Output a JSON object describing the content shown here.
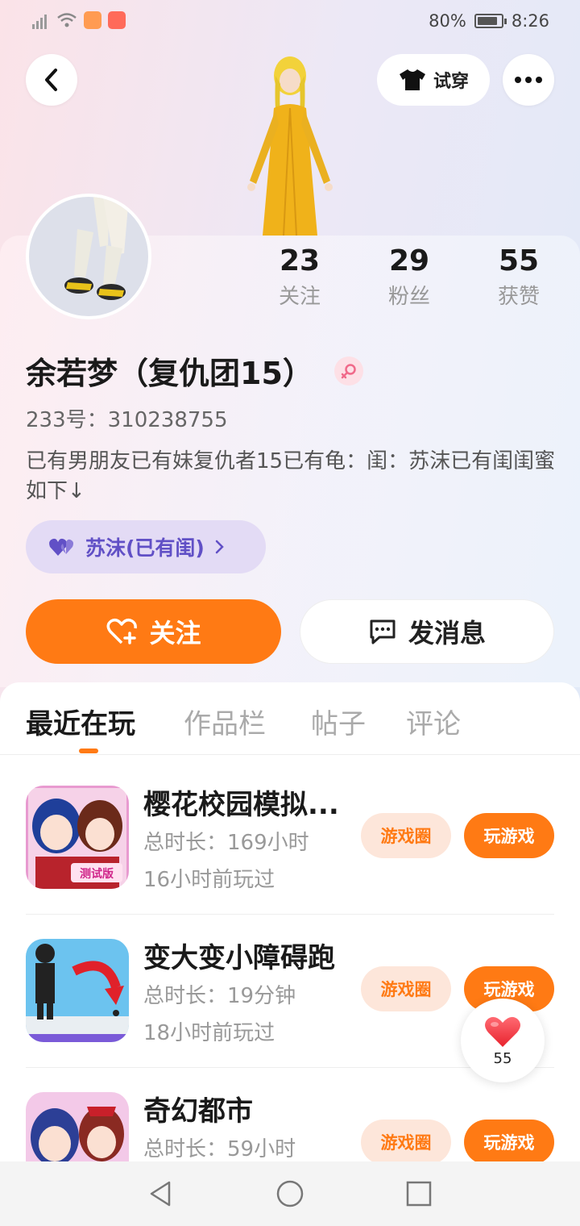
{
  "status_bar": {
    "battery": "80%",
    "battery_level": 0.8,
    "time": "8:26"
  },
  "header": {
    "try_on_label": "试穿"
  },
  "profile": {
    "stats": [
      {
        "value": "23",
        "label": "关注"
      },
      {
        "value": "29",
        "label": "粉丝"
      },
      {
        "value": "55",
        "label": "获赞"
      }
    ],
    "name": "余若梦（复仇团15）",
    "gender": "female",
    "uid": "233号：310238755",
    "bio": "已有男朋友已有妹复仇者15已有龟：闺：苏沫已有闺闺蜜如下↓",
    "relation_tag": "苏沫(已有闺)",
    "follow_label": "关注",
    "message_label": "发消息"
  },
  "tabs": [
    {
      "label": "最近在玩",
      "active": true
    },
    {
      "label": "作品栏",
      "active": false
    },
    {
      "label": "帖子",
      "active": false
    },
    {
      "label": "评论",
      "active": false
    }
  ],
  "games": [
    {
      "title": "樱花校园模拟...",
      "duration": "总时长：169小时",
      "last_played": "16小时前玩过",
      "circle_label": "游戏圈",
      "play_label": "玩游戏"
    },
    {
      "title": "变大变小障碍跑",
      "duration": "总时长：19分钟",
      "last_played": "18小时前玩过",
      "circle_label": "游戏圈",
      "play_label": "玩游戏"
    },
    {
      "title": "奇幻都市",
      "duration": "总时长：59小时",
      "last_played": "",
      "circle_label": "游戏圈",
      "play_label": "玩游戏"
    }
  ],
  "like_fab": {
    "count": "55"
  },
  "colors": {
    "accent": "#ff7a14",
    "chip_bg": "#fde6da",
    "tag_bg": "#e3dbf5",
    "tag_text": "#6150c6"
  }
}
